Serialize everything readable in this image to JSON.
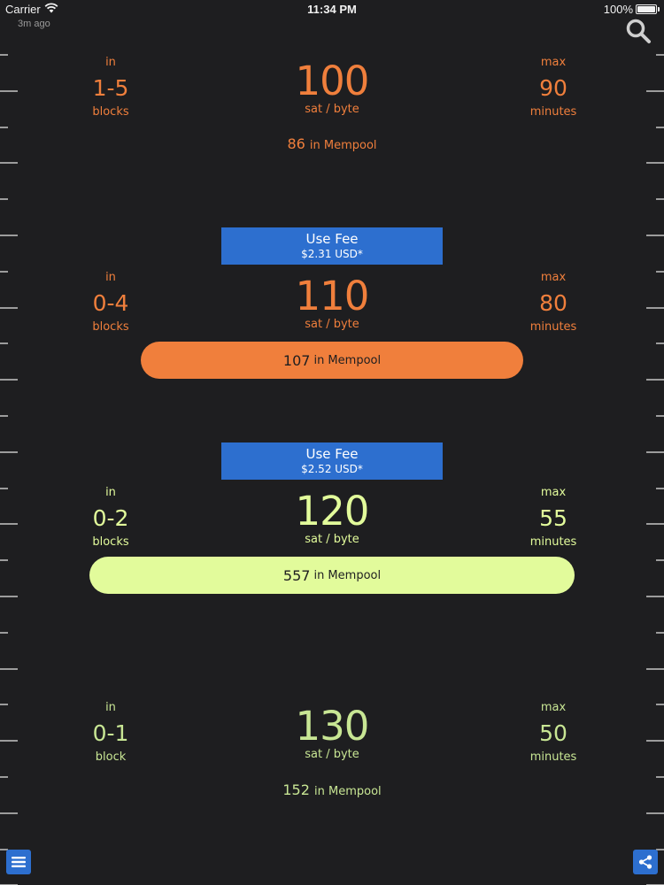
{
  "status": {
    "carrier": "Carrier",
    "time": "11:34 PM",
    "battery": "100%"
  },
  "updated": "3m ago",
  "colors": {
    "orange": "#f07f3c",
    "lime": "#e2fb9b",
    "pale_green": "#c8e694",
    "blue": "#2d6fcf",
    "background": "#1e1e20"
  },
  "tiers": [
    {
      "in_label": "in",
      "blocks": "1-5",
      "blocks_unit": "blocks",
      "fee": "100",
      "fee_unit": "sat / byte",
      "max_label": "max",
      "minutes": "90",
      "minutes_unit": "minutes",
      "mempool_count": "86",
      "mempool_label": "in Mempool"
    },
    {
      "in_label": "in",
      "blocks": "0-4",
      "blocks_unit": "blocks",
      "fee": "110",
      "fee_unit": "sat / byte",
      "max_label": "max",
      "minutes": "80",
      "minutes_unit": "minutes",
      "mempool_count": "107",
      "mempool_label": "in Mempool",
      "use_fee_label": "Use Fee",
      "use_fee_usd": "$2.31 USD*"
    },
    {
      "in_label": "in",
      "blocks": "0-2",
      "blocks_unit": "blocks",
      "fee": "120",
      "fee_unit": "sat / byte",
      "max_label": "max",
      "minutes": "55",
      "minutes_unit": "minutes",
      "mempool_count": "557",
      "mempool_label": "in Mempool",
      "use_fee_label": "Use Fee",
      "use_fee_usd": "$2.52 USD*"
    },
    {
      "in_label": "in",
      "blocks": "0-1",
      "blocks_unit": "block",
      "fee": "130",
      "fee_unit": "sat / byte",
      "max_label": "max",
      "minutes": "50",
      "minutes_unit": "minutes",
      "mempool_count": "152",
      "mempool_label": "in Mempool"
    }
  ],
  "icons": {
    "search": "search-icon",
    "menu": "hamburger-menu-icon",
    "share": "share-icon"
  }
}
